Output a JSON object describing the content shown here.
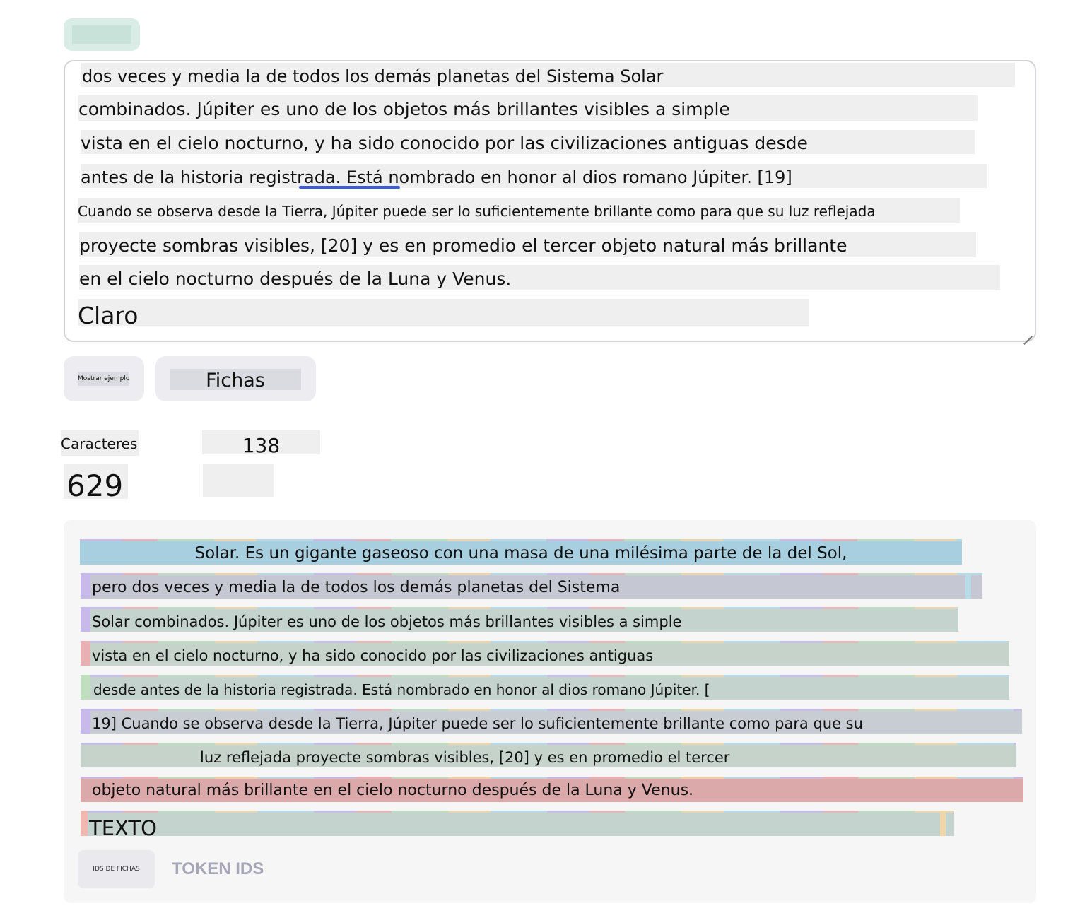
{
  "model_button": {
    "label": ""
  },
  "textarea": {
    "lines": [
      "dos veces y media la de todos los demás planetas del Sistema Solar",
      "combinados. Júpiter es uno de los objetos más brillantes visibles a simple",
      "vista en el cielo nocturno, y ha sido conocido por las civilizaciones antiguas desde",
      "antes de la historia registrada. Está nombrado en honor al dios romano Júpiter. [19]",
      "Cuando se observa desde la Tierra, Júpiter puede ser lo suficientemente brillante como para que su luz reflejada",
      "proyecte sombras visibles, [20] y es en promedio el tercer objeto natural más brillante",
      "en el cielo nocturno después de la Luna y Venus.",
      "Claro"
    ]
  },
  "buttons": {
    "show_example": "Mostrar ejemplo",
    "tokens": "Fichas"
  },
  "stats": {
    "characters_label": "Caracteres",
    "tokens_value": "138",
    "characters_value": "629",
    "tokens_label": ""
  },
  "output": {
    "lines": [
      {
        "text": "Solar. Es un gigante gaseoso con una masa de una milésima parte de la del Sol,",
        "color": "#a8cfe0"
      },
      {
        "text": "pero dos veces y media la de todos los demás planetas del Sistema",
        "color": "#c5c8d3"
      },
      {
        "text": "Solar combinados. Júpiter es uno de los objetos más brillantes visibles a simple",
        "color": "#c5d3cf"
      },
      {
        "text": "vista en el cielo nocturno, y ha sido conocido por las civilizaciones antiguas",
        "color": "#c5d3cb"
      },
      {
        "text": "desde antes de la historia registrada. Está nombrado en honor al dios romano Júpiter. [",
        "color": "#c5d3cf"
      },
      {
        "text": "19] Cuando se observa desde la Tierra, Júpiter puede ser lo suficientemente brillante como para que su",
        "color": "#c8ccd3"
      },
      {
        "text": "luz reflejada proyecte sombras visibles, [20] y es en promedio el tercer",
        "color": "#c5d3cb"
      },
      {
        "text": "objeto natural más brillante en el cielo nocturno después de la Luna y Venus.",
        "color": "#dba9a9"
      },
      {
        "text": "TEXTO",
        "color": "#c5d3cf"
      }
    ],
    "ids_button": "IDS DE FICHAS",
    "ids_label": "TOKEN IDS"
  },
  "colors": {
    "accent_underline": "#3b5bdb",
    "button_bg": "#ececf1",
    "panel_bg": "#f6f6f6"
  }
}
